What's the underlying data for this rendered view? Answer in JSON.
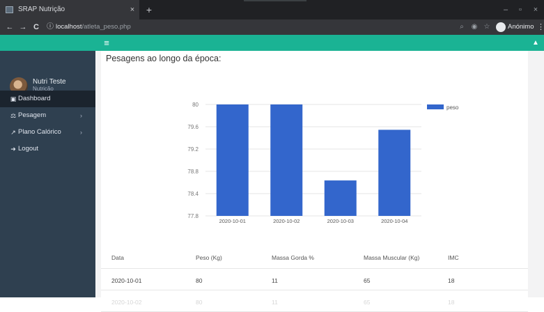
{
  "browser": {
    "tab_title": "SRAP Nutrição",
    "tab_close": "×",
    "new_tab": "+",
    "win_minimize": "–",
    "win_maximize": "▫",
    "win_close": "×",
    "back": "←",
    "forward": "→",
    "reload": "C",
    "url_host": "localhost",
    "url_path": "/atleta_peso.php",
    "profile_label": "Anónimo",
    "menu": "⋮"
  },
  "topbar": {
    "hamburger": "≡",
    "user_icon": "▲"
  },
  "sidebar": {
    "user_name": "Nutri Teste",
    "user_role": "Nutrição",
    "items": [
      {
        "icon": "▣",
        "label": "Dashboard",
        "arrow": ""
      },
      {
        "icon": "⚖",
        "label": "Pesagem",
        "arrow": "›"
      },
      {
        "icon": "↗",
        "label": "Plano Calórico",
        "arrow": "›"
      },
      {
        "icon": "➜",
        "label": "Logout",
        "arrow": ""
      }
    ]
  },
  "main": {
    "title": "Pesagens ao longo da época:"
  },
  "chart_data": {
    "type": "bar",
    "categories": [
      "2020-10-01",
      "2020-10-02",
      "2020-10-03",
      "2020-10-04"
    ],
    "series": [
      {
        "name": "peso",
        "values": [
          80,
          80,
          78.5,
          79.5
        ],
        "color": "#3366cc"
      }
    ],
    "ylim": [
      77.8,
      80
    ],
    "yticks": [
      "80",
      "79.6",
      "79.2",
      "78.8",
      "78.4",
      "77.8"
    ],
    "legend": "top-right",
    "grid": true
  },
  "table": {
    "headers": [
      "Data",
      "Peso (Kg)",
      "Massa Gorda %",
      "Massa Muscular (Kg)",
      "IMC"
    ],
    "rows": [
      [
        "2020-10-01",
        "80",
        "11",
        "65",
        "18"
      ],
      [
        "2020-10-02",
        "80",
        "11",
        "65",
        "18"
      ]
    ]
  }
}
